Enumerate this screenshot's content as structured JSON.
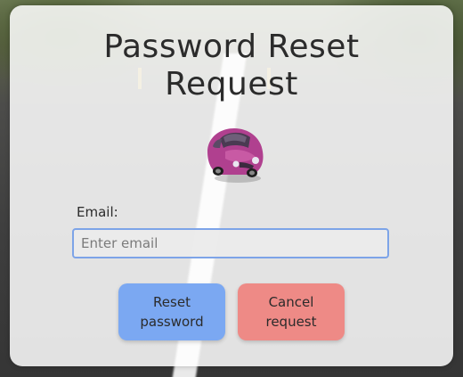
{
  "page": {
    "title": "Password Reset Request",
    "title_line1": "Password Reset",
    "title_line2": "Request"
  },
  "form": {
    "email_label": "Email:",
    "email_placeholder": "Enter email",
    "email_value": ""
  },
  "buttons": {
    "reset_line1": "Reset",
    "reset_line2": "password",
    "cancel_line1": "Cancel",
    "cancel_line2": "request"
  },
  "colors": {
    "reset_button": "#7ba8f2",
    "cancel_button": "#ee8a86",
    "input_border": "#7da4e8",
    "card_bg": "rgba(255,255,255,0.86)"
  },
  "icons": {
    "car": "car-image-icon"
  }
}
